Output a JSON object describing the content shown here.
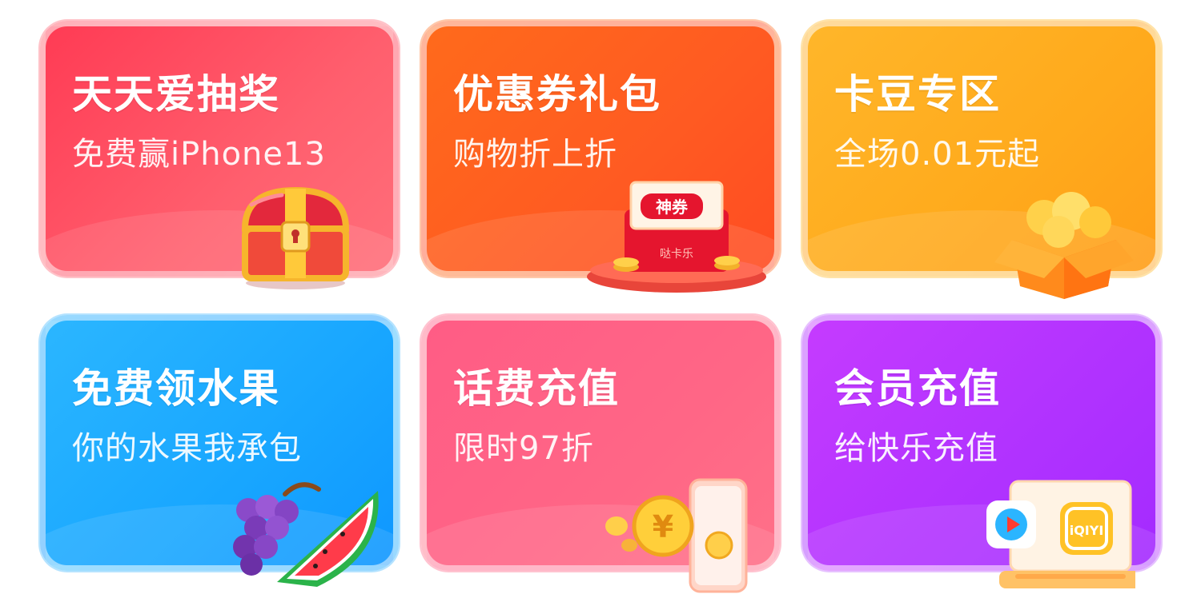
{
  "cards": [
    {
      "title": "天天爱抽奖",
      "subtitle": "免费赢iPhone13",
      "icon": "treasure-chest-icon"
    },
    {
      "title": "优惠券礼包",
      "subtitle": "购物折上折",
      "icon": "coupon-envelope-icon",
      "badge": "神券",
      "envelope_text": "哒卡乐"
    },
    {
      "title": "卡豆专区",
      "subtitle": "全场0.01元起",
      "icon": "gift-box-coins-icon"
    },
    {
      "title": "免费领水果",
      "subtitle": "你的水果我承包",
      "icon": "grapes-watermelon-icon"
    },
    {
      "title": "话费充值",
      "subtitle": "限时97折",
      "icon": "phone-coins-icon",
      "coin_symbol": "¥"
    },
    {
      "title": "会员充值",
      "subtitle": "给快乐充值",
      "icon": "video-apps-laptop-icon",
      "app_logo_text": "iQIYI"
    }
  ],
  "colors": {
    "card1": "#ff4a5f",
    "card2": "#ff5c1f",
    "card3": "#ffaa1c",
    "card4": "#18a6ff",
    "card5": "#ff6686",
    "card6": "#b032ff"
  }
}
